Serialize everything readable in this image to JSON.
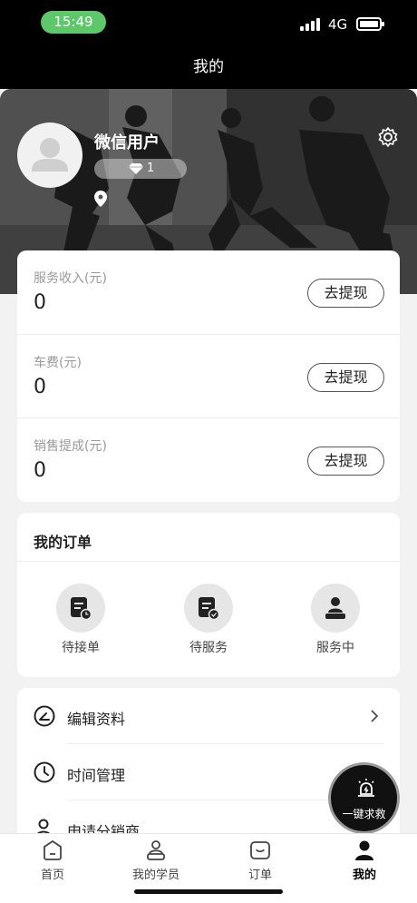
{
  "status_bar": {
    "time": "15:49",
    "network": "4G"
  },
  "nav": {
    "title": "我的"
  },
  "profile": {
    "name": "微信用户",
    "level": "1"
  },
  "earnings": [
    {
      "label": "服务收入(元)",
      "value": "0",
      "button": "去提现"
    },
    {
      "label": "车费(元)",
      "value": "0",
      "button": "去提现"
    },
    {
      "label": "销售提成(元)",
      "value": "0",
      "button": "去提现"
    }
  ],
  "orders": {
    "title": "我的订单",
    "items": [
      {
        "label": "待接单",
        "icon": "pending-order-icon"
      },
      {
        "label": "待服务",
        "icon": "awaiting-service-icon"
      },
      {
        "label": "服务中",
        "icon": "in-service-icon"
      }
    ]
  },
  "menu": [
    {
      "label": "编辑资料",
      "icon": "edit-profile-icon"
    },
    {
      "label": "时间管理",
      "icon": "clock-icon"
    },
    {
      "label": "申请分销商",
      "icon": "distributor-icon"
    }
  ],
  "sos": {
    "label": "一键求救"
  },
  "tabbar": [
    {
      "label": "首页",
      "icon": "home-icon"
    },
    {
      "label": "我的学员",
      "icon": "students-icon"
    },
    {
      "label": "订单",
      "icon": "orders-icon"
    },
    {
      "label": "我的",
      "icon": "profile-icon",
      "active": true
    }
  ]
}
